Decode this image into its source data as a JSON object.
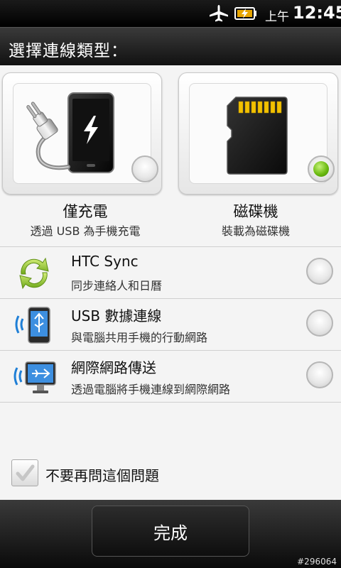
{
  "status_bar": {
    "ampm": "上午",
    "time": "12:45",
    "icons": [
      "airplane-icon",
      "battery-charging-icon"
    ]
  },
  "dialog": {
    "title": "選擇連線類型："
  },
  "tiles": [
    {
      "label": "僅充電",
      "subtitle": "透過 USB 為手機充電",
      "icon": "charger-phone-icon",
      "selected": false
    },
    {
      "label": "磁碟機",
      "subtitle": "裝載為磁碟機",
      "icon": "sd-card-icon",
      "selected": true
    }
  ],
  "options": [
    {
      "title": "HTC Sync",
      "subtitle": "同步連絡人和日曆",
      "icon": "sync-arrows-icon",
      "selected": false
    },
    {
      "title": "USB 數據連線",
      "subtitle": "與電腦共用手機的行動網路",
      "icon": "usb-tethering-icon",
      "selected": false
    },
    {
      "title": "網際網路傳送",
      "subtitle": "透過電腦將手機連線到網際網路",
      "icon": "internet-pass-through-icon",
      "selected": false
    }
  ],
  "dont_ask": {
    "label": "不要再問這個問題",
    "checked": false
  },
  "done_button": {
    "label": "完成"
  },
  "watermark": "#296064",
  "colors": {
    "selected_radio": "#6dbb12",
    "background": "#f4f4f4"
  }
}
